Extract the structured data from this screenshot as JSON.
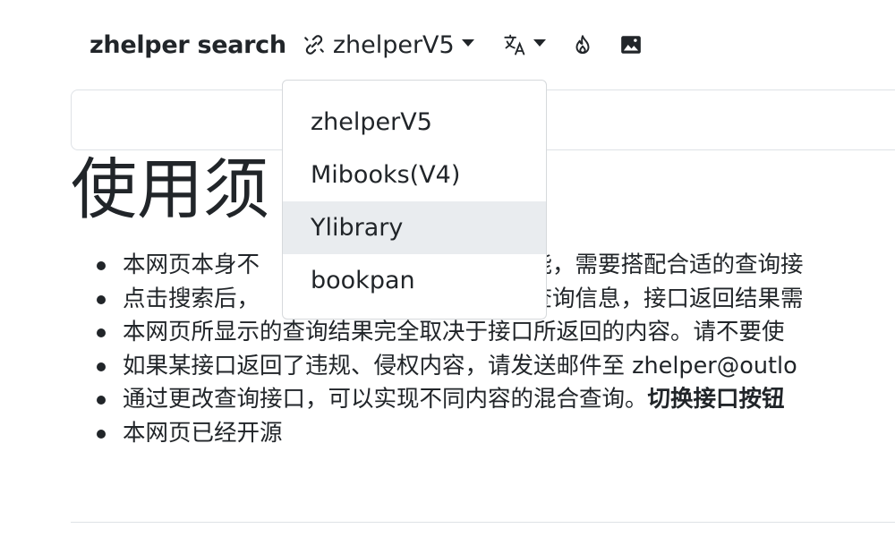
{
  "navbar": {
    "brand": "zhelper search",
    "api_selector": {
      "icon": "link-icon",
      "label": "zhelperV5"
    },
    "language_icon": "translate-icon",
    "theme_icon": "fire-icon",
    "image_icon": "image-icon"
  },
  "search": {
    "value": "",
    "placeholder": ""
  },
  "heading": "使用须",
  "notices": [
    {
      "left": "本网页本身不",
      "right": "功能，需要搭配合适的查询接"
    },
    {
      "left": "点击搜索后，",
      "right": "送查询信息，接口返回结果需"
    },
    {
      "left": "本网页所显示的查询结果完全取决于接口所返回的内容。请不要使"
    },
    {
      "left": "如果某接口返回了违规、侵权内容，请发送邮件至 zhelper@outlo"
    },
    {
      "left": "通过更改查询接口，可以实现不同内容的混合查询。",
      "bold": "切换接口按钮"
    },
    {
      "left": "本网页已经开源"
    }
  ],
  "dropdown": {
    "items": [
      "zhelperV5",
      "Mibooks(V4)",
      "Ylibrary",
      "bookpan"
    ],
    "highlighted": "Ylibrary"
  },
  "colors": {
    "text": "#212529",
    "border": "#dee2e6",
    "hover": "#e9ecef"
  }
}
